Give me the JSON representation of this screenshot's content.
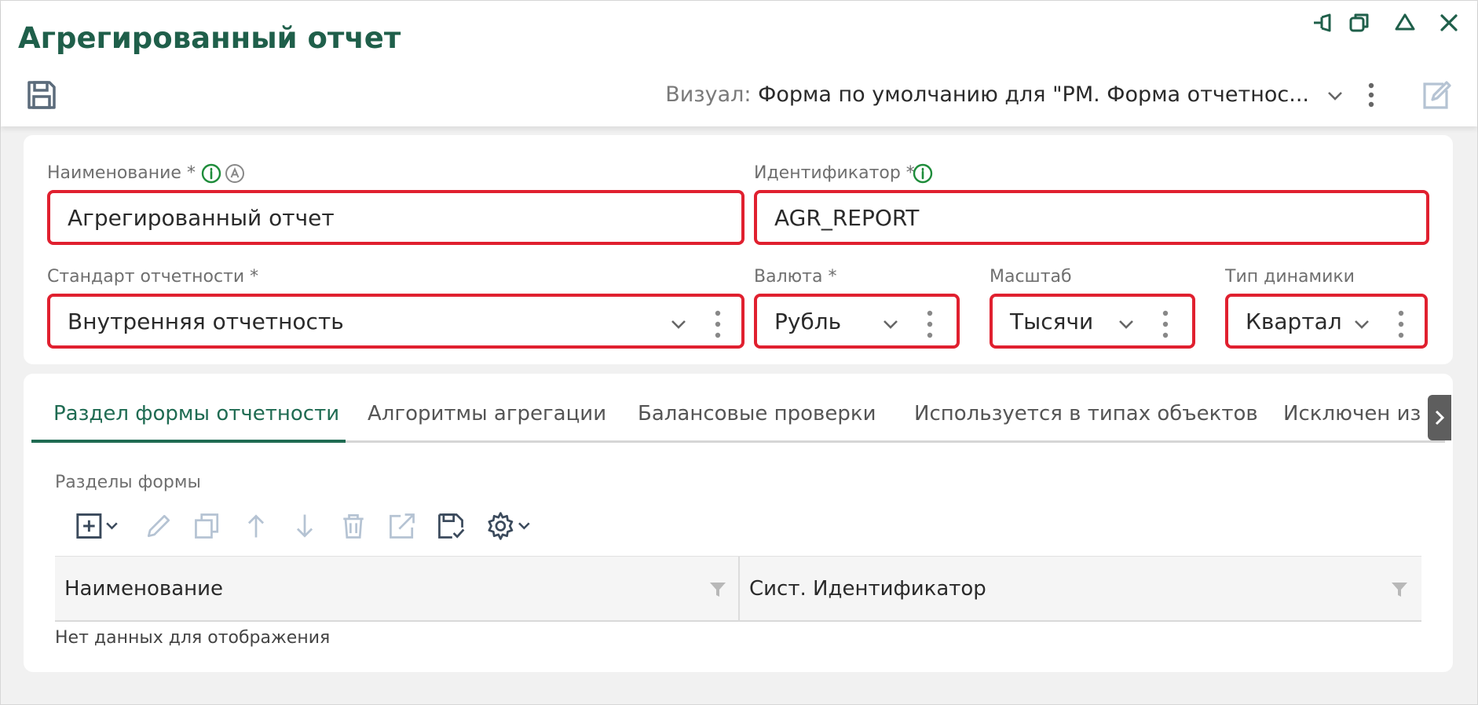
{
  "window": {
    "title": "Агрегированный отчет",
    "controls": [
      "pin-icon",
      "restore-icon",
      "collapse-icon",
      "close-icon"
    ]
  },
  "toolbar": {
    "save_icon": "save-icon",
    "visual_label": "Визуал:",
    "visual_value": "Форма по умолчанию для \"РМ. Форма отчетнос...",
    "edit_icon": "edit-icon"
  },
  "form": {
    "name": {
      "label": "Наименование *",
      "value": "Агрегированный отчет"
    },
    "identifier": {
      "label": "Идентификатор *",
      "value": "AGR_REPORT"
    },
    "standard": {
      "label": "Стандарт отчетности *",
      "value": "Внутренняя отчетность"
    },
    "currency": {
      "label": "Валюта *",
      "value": "Рубль"
    },
    "scale": {
      "label": "Масштаб",
      "value": "Тысячи"
    },
    "dynamics": {
      "label": "Тип динамики",
      "value": "Квартал"
    }
  },
  "tabs": [
    {
      "label": "Раздел формы отчетности",
      "active": true
    },
    {
      "label": "Алгоритмы агрегации",
      "active": false
    },
    {
      "label": "Балансовые проверки",
      "active": false
    },
    {
      "label": "Используется в типах объектов",
      "active": false
    },
    {
      "label": "Исключен из т",
      "active": false
    }
  ],
  "section": {
    "title": "Разделы формы",
    "toolbar_icons": [
      "add-icon",
      "edit-pencil-icon",
      "copy-icon",
      "move-up-icon",
      "move-down-icon",
      "delete-icon",
      "open-external-icon",
      "save-check-icon",
      "settings-icon"
    ],
    "columns": [
      "Наименование",
      "Сист. Идентификатор"
    ],
    "empty_text": "Нет данных для отображения"
  },
  "colors": {
    "accent": "#1f6b52",
    "title": "#1f5f4a",
    "error_border": "#e0202f",
    "icon_muted": "#b5c3d3"
  }
}
